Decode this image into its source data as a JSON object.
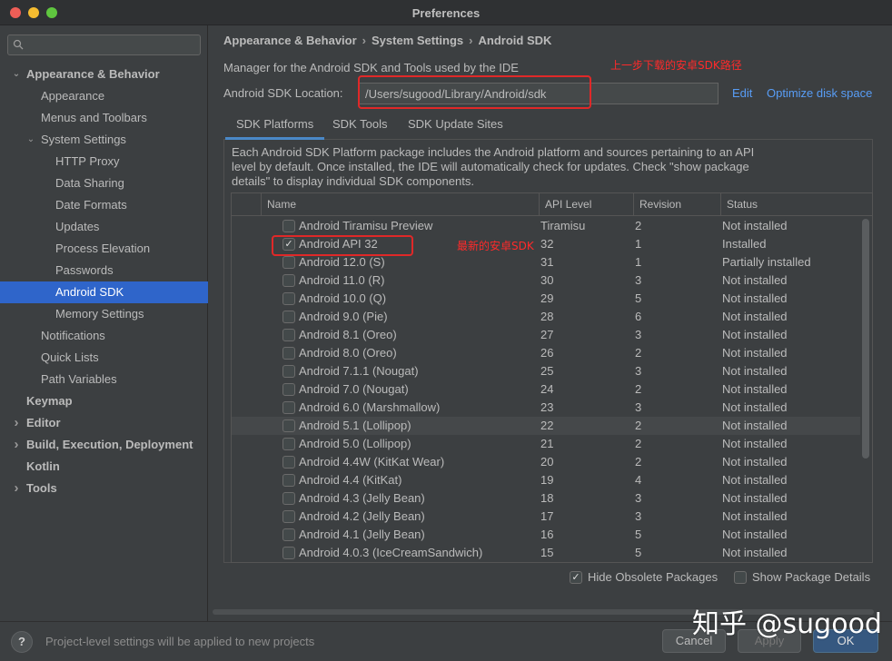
{
  "window": {
    "title": "Preferences"
  },
  "search": {
    "placeholder": "Q-",
    "value": ""
  },
  "sidebar": {
    "items": [
      {
        "label": "Appearance & Behavior",
        "level": 0,
        "bold": true,
        "arrow": "down"
      },
      {
        "label": "Appearance",
        "level": 1
      },
      {
        "label": "Menus and Toolbars",
        "level": 1
      },
      {
        "label": "System Settings",
        "level": 1,
        "arrow": "down"
      },
      {
        "label": "HTTP Proxy",
        "level": 2
      },
      {
        "label": "Data Sharing",
        "level": 2
      },
      {
        "label": "Date Formats",
        "level": 2
      },
      {
        "label": "Updates",
        "level": 2
      },
      {
        "label": "Process Elevation",
        "level": 2
      },
      {
        "label": "Passwords",
        "level": 2
      },
      {
        "label": "Android SDK",
        "level": 2,
        "selected": true
      },
      {
        "label": "Memory Settings",
        "level": 2
      },
      {
        "label": "Notifications",
        "level": 1
      },
      {
        "label": "Quick Lists",
        "level": 1
      },
      {
        "label": "Path Variables",
        "level": 1
      },
      {
        "label": "Keymap",
        "level": 0,
        "bold": true
      },
      {
        "label": "Editor",
        "level": 0,
        "bold": true,
        "arrow": "right"
      },
      {
        "label": "Build, Execution, Deployment",
        "level": 0,
        "bold": true,
        "arrow": "right"
      },
      {
        "label": "Kotlin",
        "level": 0,
        "bold": true
      },
      {
        "label": "Tools",
        "level": 0,
        "bold": true,
        "arrow": "right"
      }
    ]
  },
  "breadcrumb": [
    "Appearance & Behavior",
    "System Settings",
    "Android SDK"
  ],
  "main": {
    "description": "Manager for the Android SDK and Tools used by the IDE",
    "sdk_location_label": "Android SDK Location:",
    "sdk_location_value": "/Users/sugood/Library/Android/sdk",
    "edit_link": "Edit",
    "optimize_link": "Optimize disk space",
    "tabs": [
      "SDK Platforms",
      "SDK Tools",
      "SDK Update Sites"
    ],
    "panel_text": "Each Android SDK Platform package includes the Android platform and sources pertaining to an API level by default. Once installed, the IDE will automatically check for updates. Check \"show package details\" to display individual SDK components.",
    "table": {
      "headers": [
        "Name",
        "API Level",
        "Revision",
        "Status"
      ],
      "rows": [
        {
          "name": "Android Tiramisu Preview",
          "api": "Tiramisu",
          "rev": "2",
          "status": "Not installed",
          "checked": false
        },
        {
          "name": "Android API 32",
          "api": "32",
          "rev": "1",
          "status": "Installed",
          "checked": true
        },
        {
          "name": "Android 12.0 (S)",
          "api": "31",
          "rev": "1",
          "status": "Partially installed",
          "checked": false
        },
        {
          "name": "Android 11.0 (R)",
          "api": "30",
          "rev": "3",
          "status": "Not installed",
          "checked": false
        },
        {
          "name": "Android 10.0 (Q)",
          "api": "29",
          "rev": "5",
          "status": "Not installed",
          "checked": false
        },
        {
          "name": "Android 9.0 (Pie)",
          "api": "28",
          "rev": "6",
          "status": "Not installed",
          "checked": false
        },
        {
          "name": "Android 8.1 (Oreo)",
          "api": "27",
          "rev": "3",
          "status": "Not installed",
          "checked": false
        },
        {
          "name": "Android 8.0 (Oreo)",
          "api": "26",
          "rev": "2",
          "status": "Not installed",
          "checked": false
        },
        {
          "name": "Android 7.1.1 (Nougat)",
          "api": "25",
          "rev": "3",
          "status": "Not installed",
          "checked": false
        },
        {
          "name": "Android 7.0 (Nougat)",
          "api": "24",
          "rev": "2",
          "status": "Not installed",
          "checked": false
        },
        {
          "name": "Android 6.0 (Marshmallow)",
          "api": "23",
          "rev": "3",
          "status": "Not installed",
          "checked": false
        },
        {
          "name": "Android 5.1 (Lollipop)",
          "api": "22",
          "rev": "2",
          "status": "Not installed",
          "checked": false,
          "highlight": true
        },
        {
          "name": "Android 5.0 (Lollipop)",
          "api": "21",
          "rev": "2",
          "status": "Not installed",
          "checked": false
        },
        {
          "name": "Android 4.4W (KitKat Wear)",
          "api": "20",
          "rev": "2",
          "status": "Not installed",
          "checked": false
        },
        {
          "name": "Android 4.4 (KitKat)",
          "api": "19",
          "rev": "4",
          "status": "Not installed",
          "checked": false
        },
        {
          "name": "Android 4.3 (Jelly Bean)",
          "api": "18",
          "rev": "3",
          "status": "Not installed",
          "checked": false
        },
        {
          "name": "Android 4.2 (Jelly Bean)",
          "api": "17",
          "rev": "3",
          "status": "Not installed",
          "checked": false
        },
        {
          "name": "Android 4.1 (Jelly Bean)",
          "api": "16",
          "rev": "5",
          "status": "Not installed",
          "checked": false
        },
        {
          "name": "Android 4.0.3 (IceCreamSandwich)",
          "api": "15",
          "rev": "5",
          "status": "Not installed",
          "checked": false
        }
      ]
    },
    "hide_obsolete_label": "Hide Obsolete Packages",
    "hide_obsolete_checked": true,
    "show_details_label": "Show Package Details",
    "show_details_checked": false
  },
  "annotations": {
    "path_note": "上一步下载的安卓SDK路径",
    "api_note": "最新的安卓SDK"
  },
  "footer": {
    "help_label": "?",
    "message": "Project-level settings will be applied to new projects",
    "cancel_label": "Cancel",
    "apply_label": "Apply",
    "ok_label": "OK"
  },
  "watermark": "知乎 @sugood",
  "colors": {
    "selection": "#2f65ca",
    "link": "#589df6",
    "annotation": "#e02828",
    "primary_button": "#365880"
  }
}
